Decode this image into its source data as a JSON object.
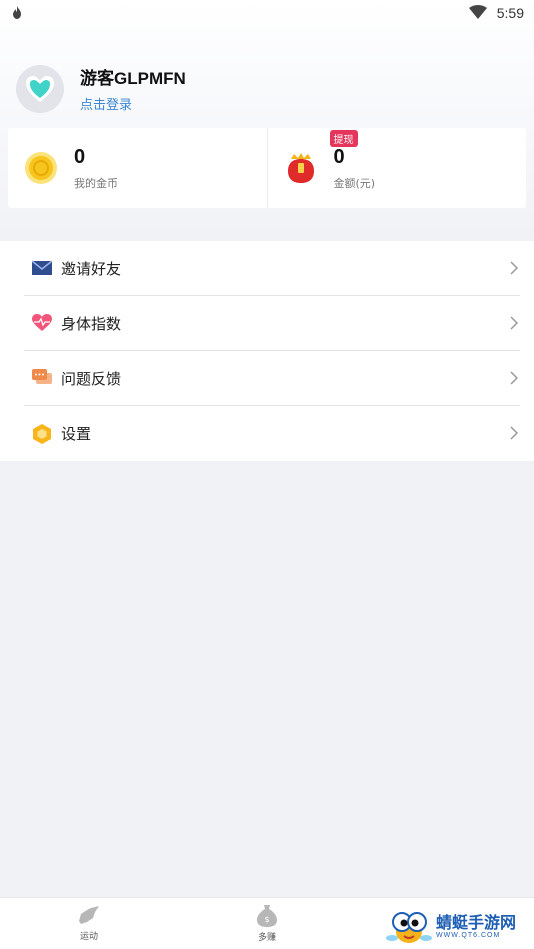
{
  "status_bar": {
    "time": "5:59"
  },
  "profile": {
    "username": "游客GLPMFN",
    "login_text": "点击登录"
  },
  "stats": {
    "coins": {
      "value": "0",
      "label": "我的金币"
    },
    "balance": {
      "value": "0",
      "label": "金额(元)",
      "badge": "提现"
    }
  },
  "menu": {
    "items": [
      {
        "label": "邀请好友",
        "icon": "envelope-icon"
      },
      {
        "label": "身体指数",
        "icon": "heart-pulse-icon"
      },
      {
        "label": "问题反馈",
        "icon": "chat-bubble-icon"
      },
      {
        "label": "设置",
        "icon": "hexagon-settings-icon"
      }
    ]
  },
  "bottom_nav": {
    "tabs": [
      {
        "label": "运动",
        "icon": "shoe-icon"
      },
      {
        "label": "多赚",
        "icon": "money-bag-icon"
      }
    ]
  },
  "watermark": {
    "title": "蜻蜓手游网",
    "url": "WWW.QT6.COM"
  },
  "colors": {
    "accent_link": "#3c87d2",
    "badge_red": "#e6355b",
    "coin_gold": "#f7c51b"
  }
}
